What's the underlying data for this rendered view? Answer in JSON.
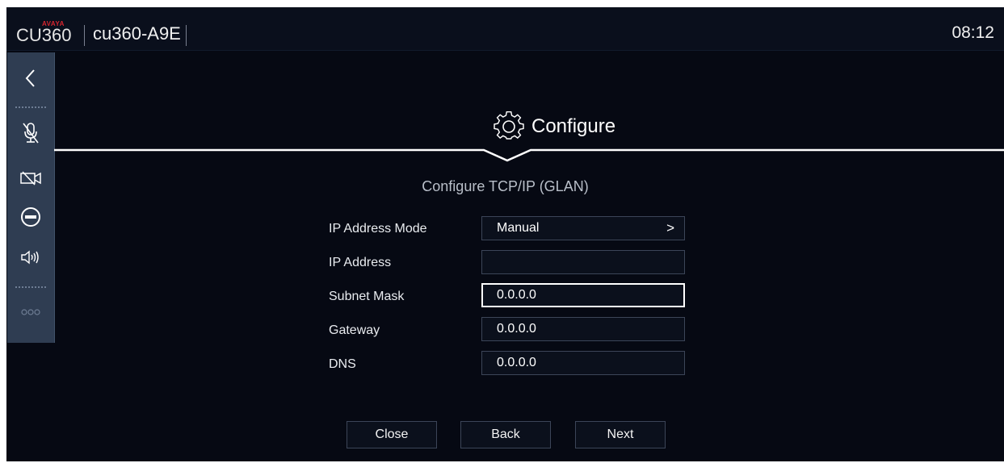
{
  "topbar": {
    "brand_small": "AVAYA",
    "brand_logo": "CU360",
    "device_name": "cu360-A9E",
    "clock": "08:12"
  },
  "sidebar": {
    "items": [
      {
        "name": "back-arrow-icon"
      },
      {
        "name": "microphone-muted-icon"
      },
      {
        "name": "camera-off-icon"
      },
      {
        "name": "do-not-disturb-icon"
      },
      {
        "name": "volume-icon"
      },
      {
        "name": "more-icon"
      }
    ]
  },
  "header": {
    "title": "Configure",
    "icon": "gear-icon",
    "subtitle": "Configure TCP/IP (GLAN)"
  },
  "form": {
    "ip_mode_label": "IP Address Mode",
    "ip_mode_value": "Manual",
    "ip_mode_chevron": ">",
    "ip_address_label": "IP Address",
    "subnet_label": "Subnet Mask",
    "subnet_value": "0.0.0.0",
    "gateway_label": "Gateway",
    "gateway_value": "0.0.0.0",
    "dns_label": "DNS",
    "dns_value": "0.0.0.0"
  },
  "buttons": {
    "close": "Close",
    "back": "Back",
    "next": "Next"
  },
  "colors": {
    "background": "#060913",
    "sidebar": "#2f3d52",
    "brand_red": "#d8262f",
    "text": "#ffffff"
  }
}
